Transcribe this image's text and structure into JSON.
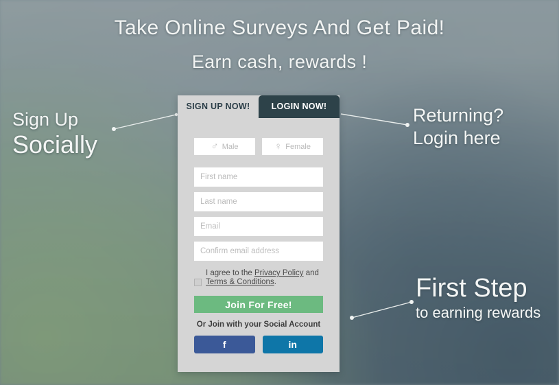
{
  "hero": {
    "headline_line1": "Take Online Surveys And Get Paid!",
    "headline_line2": "Earn cash, rewards !"
  },
  "annotations": {
    "signup_socially": {
      "line1": "Sign Up",
      "line2": "Socially"
    },
    "returning": {
      "line1": "Returning?",
      "line2": "Login here"
    },
    "first_step": {
      "line1": "First Step",
      "line2": "to earning rewards"
    }
  },
  "card": {
    "tabs": [
      {
        "label": "SIGN UP NOW!",
        "active": true
      },
      {
        "label": "LOGIN NOW!",
        "active": false
      }
    ],
    "gender": {
      "male_label": "Male",
      "male_symbol": "♂",
      "female_label": "Female",
      "female_symbol": "♀"
    },
    "fields": {
      "first_name_placeholder": "First name",
      "first_name_value": "",
      "last_name_placeholder": "Last name",
      "last_name_value": "",
      "email_placeholder": "Email",
      "email_value": "",
      "confirm_email_placeholder": "Confirm email address",
      "confirm_email_value": ""
    },
    "terms": {
      "prefix": "I agree to the ",
      "privacy_policy": "Privacy Policy",
      "conjunction": " and ",
      "terms_conditions": "Terms & Conditions",
      "suffix": ".",
      "checked": false
    },
    "join_button": "Join For Free!",
    "social_caption": "Or Join with your Social Account",
    "social": {
      "facebook_glyph": "f",
      "linkedin_glyph": "in"
    }
  },
  "colors": {
    "card_background": "#d5d5d5",
    "tab_active_text": "#2b3e48",
    "tab_inactive_background": "#2d4249",
    "join_button": "#6cba80",
    "facebook": "#3b5998",
    "linkedin": "#0e76a8",
    "backdrop": "#7b8b93",
    "annotation_text": "#f4f6f5"
  }
}
